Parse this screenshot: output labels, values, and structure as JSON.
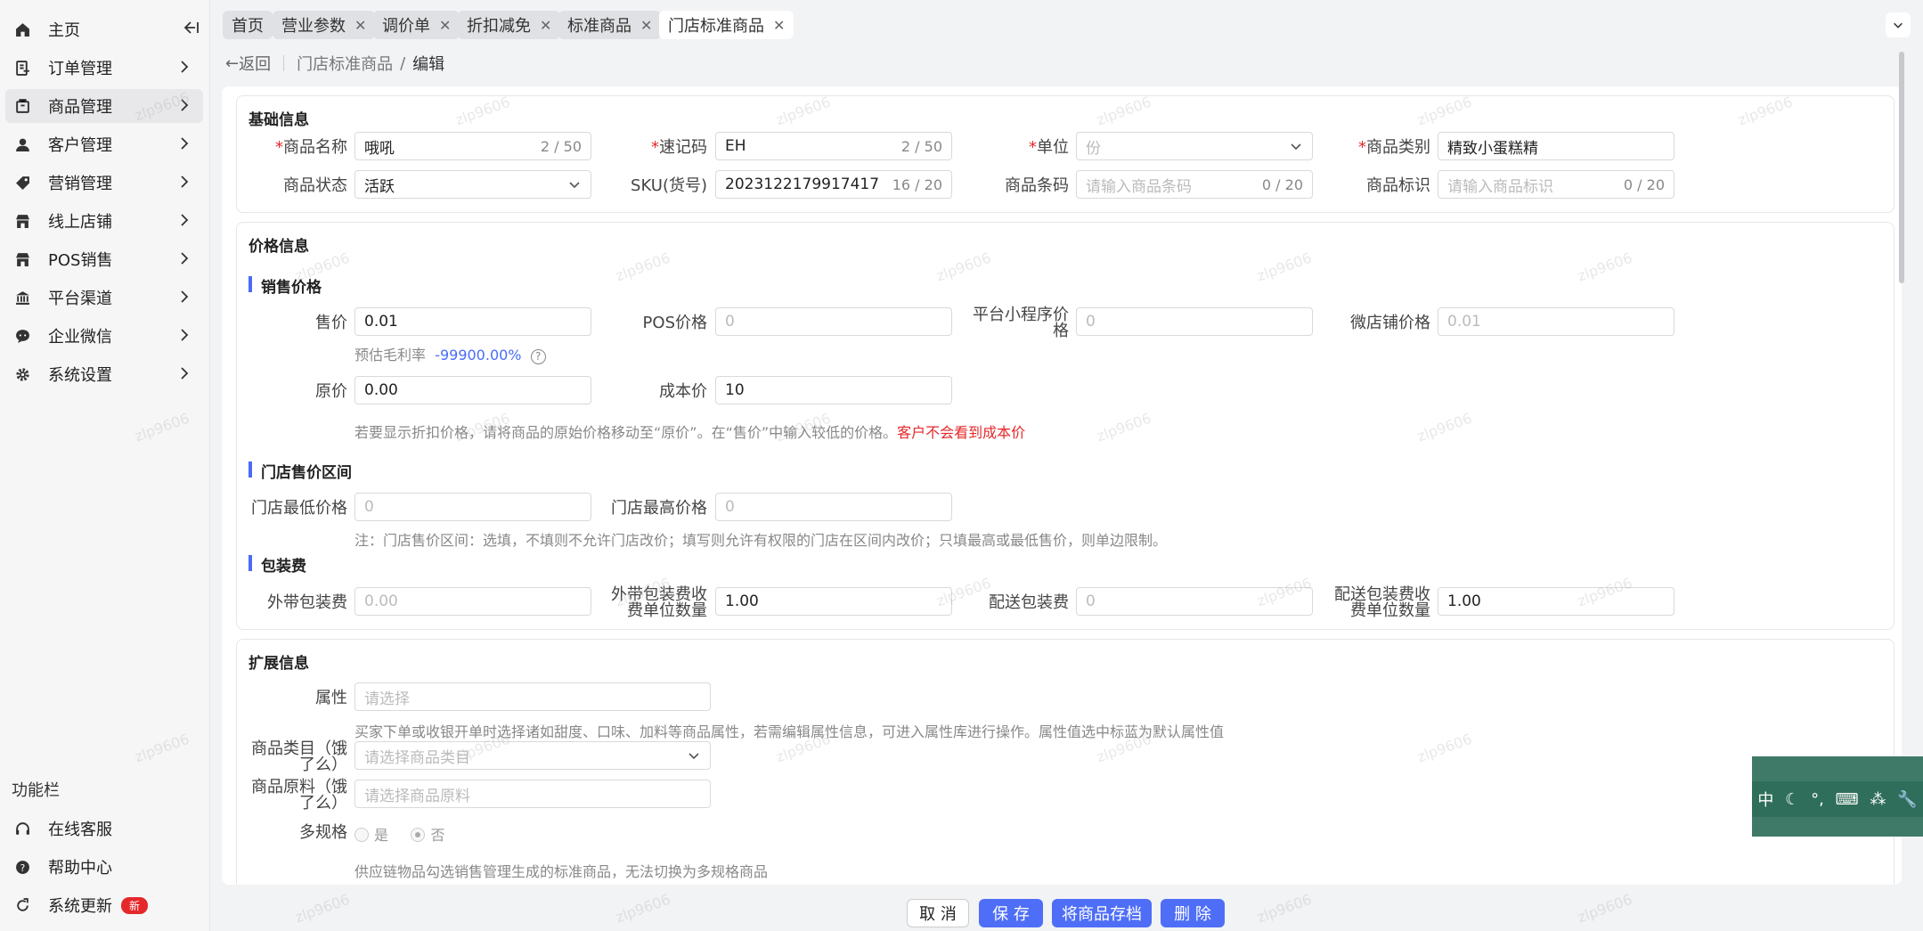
{
  "sidebar": {
    "items": [
      {
        "label": "主页"
      },
      {
        "label": "订单管理"
      },
      {
        "label": "商品管理"
      },
      {
        "label": "客户管理"
      },
      {
        "label": "营销管理"
      },
      {
        "label": "线上店铺"
      },
      {
        "label": "POS销售"
      },
      {
        "label": "平台渠道"
      },
      {
        "label": "企业微信"
      },
      {
        "label": "系统设置"
      }
    ],
    "function_title": "功能栏",
    "functions": [
      {
        "label": "在线客服"
      },
      {
        "label": "帮助中心"
      },
      {
        "label": "系统更新",
        "badge": "新"
      }
    ]
  },
  "tabs": [
    {
      "label": "首页"
    },
    {
      "label": "营业参数"
    },
    {
      "label": "调价单"
    },
    {
      "label": "折扣减免"
    },
    {
      "label": "标准商品"
    },
    {
      "label": "门店标准商品"
    }
  ],
  "breadcrumb": {
    "back": "返回",
    "parent": "门店标准商品",
    "separator": "/",
    "current": "编辑"
  },
  "basic": {
    "title": "基础信息",
    "name_label": "商品名称",
    "name_value": "哦吼",
    "name_count": "2 / 50",
    "code_label": "速记码",
    "code_value": "EH",
    "code_count": "2 / 50",
    "unit_label": "单位",
    "unit_placeholder": "份",
    "category_label": "商品类别",
    "category_value": "精致小蛋糕精",
    "status_label": "商品状态",
    "status_value": "活跃",
    "sku_label": "SKU(货号)",
    "sku_value": "2023122179917417",
    "sku_count": "16 / 20",
    "barcode_label": "商品条码",
    "barcode_placeholder": "请输入商品条码",
    "barcode_count": "0 / 20",
    "mark_label": "商品标识",
    "mark_placeholder": "请输入商品标识",
    "mark_count": "0 / 20"
  },
  "price": {
    "title": "价格信息",
    "sales_title": "销售价格",
    "price_label": "售价",
    "price_value": "0.01",
    "pos_label": "POS价格",
    "pos_placeholder": "0",
    "mini_label_1": "平台小程序价",
    "mini_label_2": "格",
    "mini_placeholder": "0",
    "wd_label": "微店铺价格",
    "wd_placeholder": "0.01",
    "margin_label": "预估毛利率",
    "margin_value": "-99900.00%",
    "orig_label": "原价",
    "orig_value": "0.00",
    "cost_label": "成本价",
    "cost_value": "10",
    "hint": "若要显示折扣价格，请将商品的原始价格移动至“原价”。在“售价”中输入较低的价格。",
    "hint_warn": "客户不会看到成本价",
    "range_title": "门店售价区间",
    "min_label": "门店最低价格",
    "min_placeholder": "0",
    "max_label": "门店最高价格",
    "max_placeholder": "0",
    "range_note": "注：门店售价区间：选填，不填则不允许门店改价；填写则允许有权限的门店在区间内改价；只填最高或最低售价，则单边限制。",
    "pack_title": "包装费",
    "takeout_label": "外带包装费",
    "takeout_placeholder": "0.00",
    "takeout_unit_label_1": "外带包装费收",
    "takeout_unit_label_2": "费单位数量",
    "takeout_unit_value": "1.00",
    "deliver_label": "配送包装费",
    "deliver_placeholder": "0",
    "deliver_unit_label_1": "配送包装费收",
    "deliver_unit_label_2": "费单位数量",
    "deliver_unit_value": "1.00"
  },
  "ext": {
    "title": "扩展信息",
    "attr_label": "属性",
    "attr_placeholder": "请选择",
    "attr_note": "买家下单或收银开单时选择诸如甜度、口味、加料等商品属性，若需编辑属性信息，可进入属性库进行操作。属性值选中标蓝为默认属性值",
    "cat_label_1": "商品类目（饿",
    "cat_label_2": "了么）",
    "cat_placeholder": "请选择商品类目",
    "mat_label_1": "商品原料（饿",
    "mat_label_2": "了么）",
    "mat_placeholder": "请选择商品原料",
    "spec_label": "多规格",
    "spec_yes": "是",
    "spec_no": "否",
    "spec_note": "供应链物品勾选销售管理生成的标准商品，无法切换为多规格商品"
  },
  "actions": {
    "cancel": "取 消",
    "save": "保 存",
    "archive": "将商品存档",
    "delete": "删 除"
  },
  "ime": {
    "lang": "中"
  },
  "watermark": "zlp9606",
  "colors": {
    "primary": "#4f6ef7",
    "accent_bar": "#4a6cf7",
    "danger": "#e5282a",
    "ime": "#2f6e5a"
  }
}
